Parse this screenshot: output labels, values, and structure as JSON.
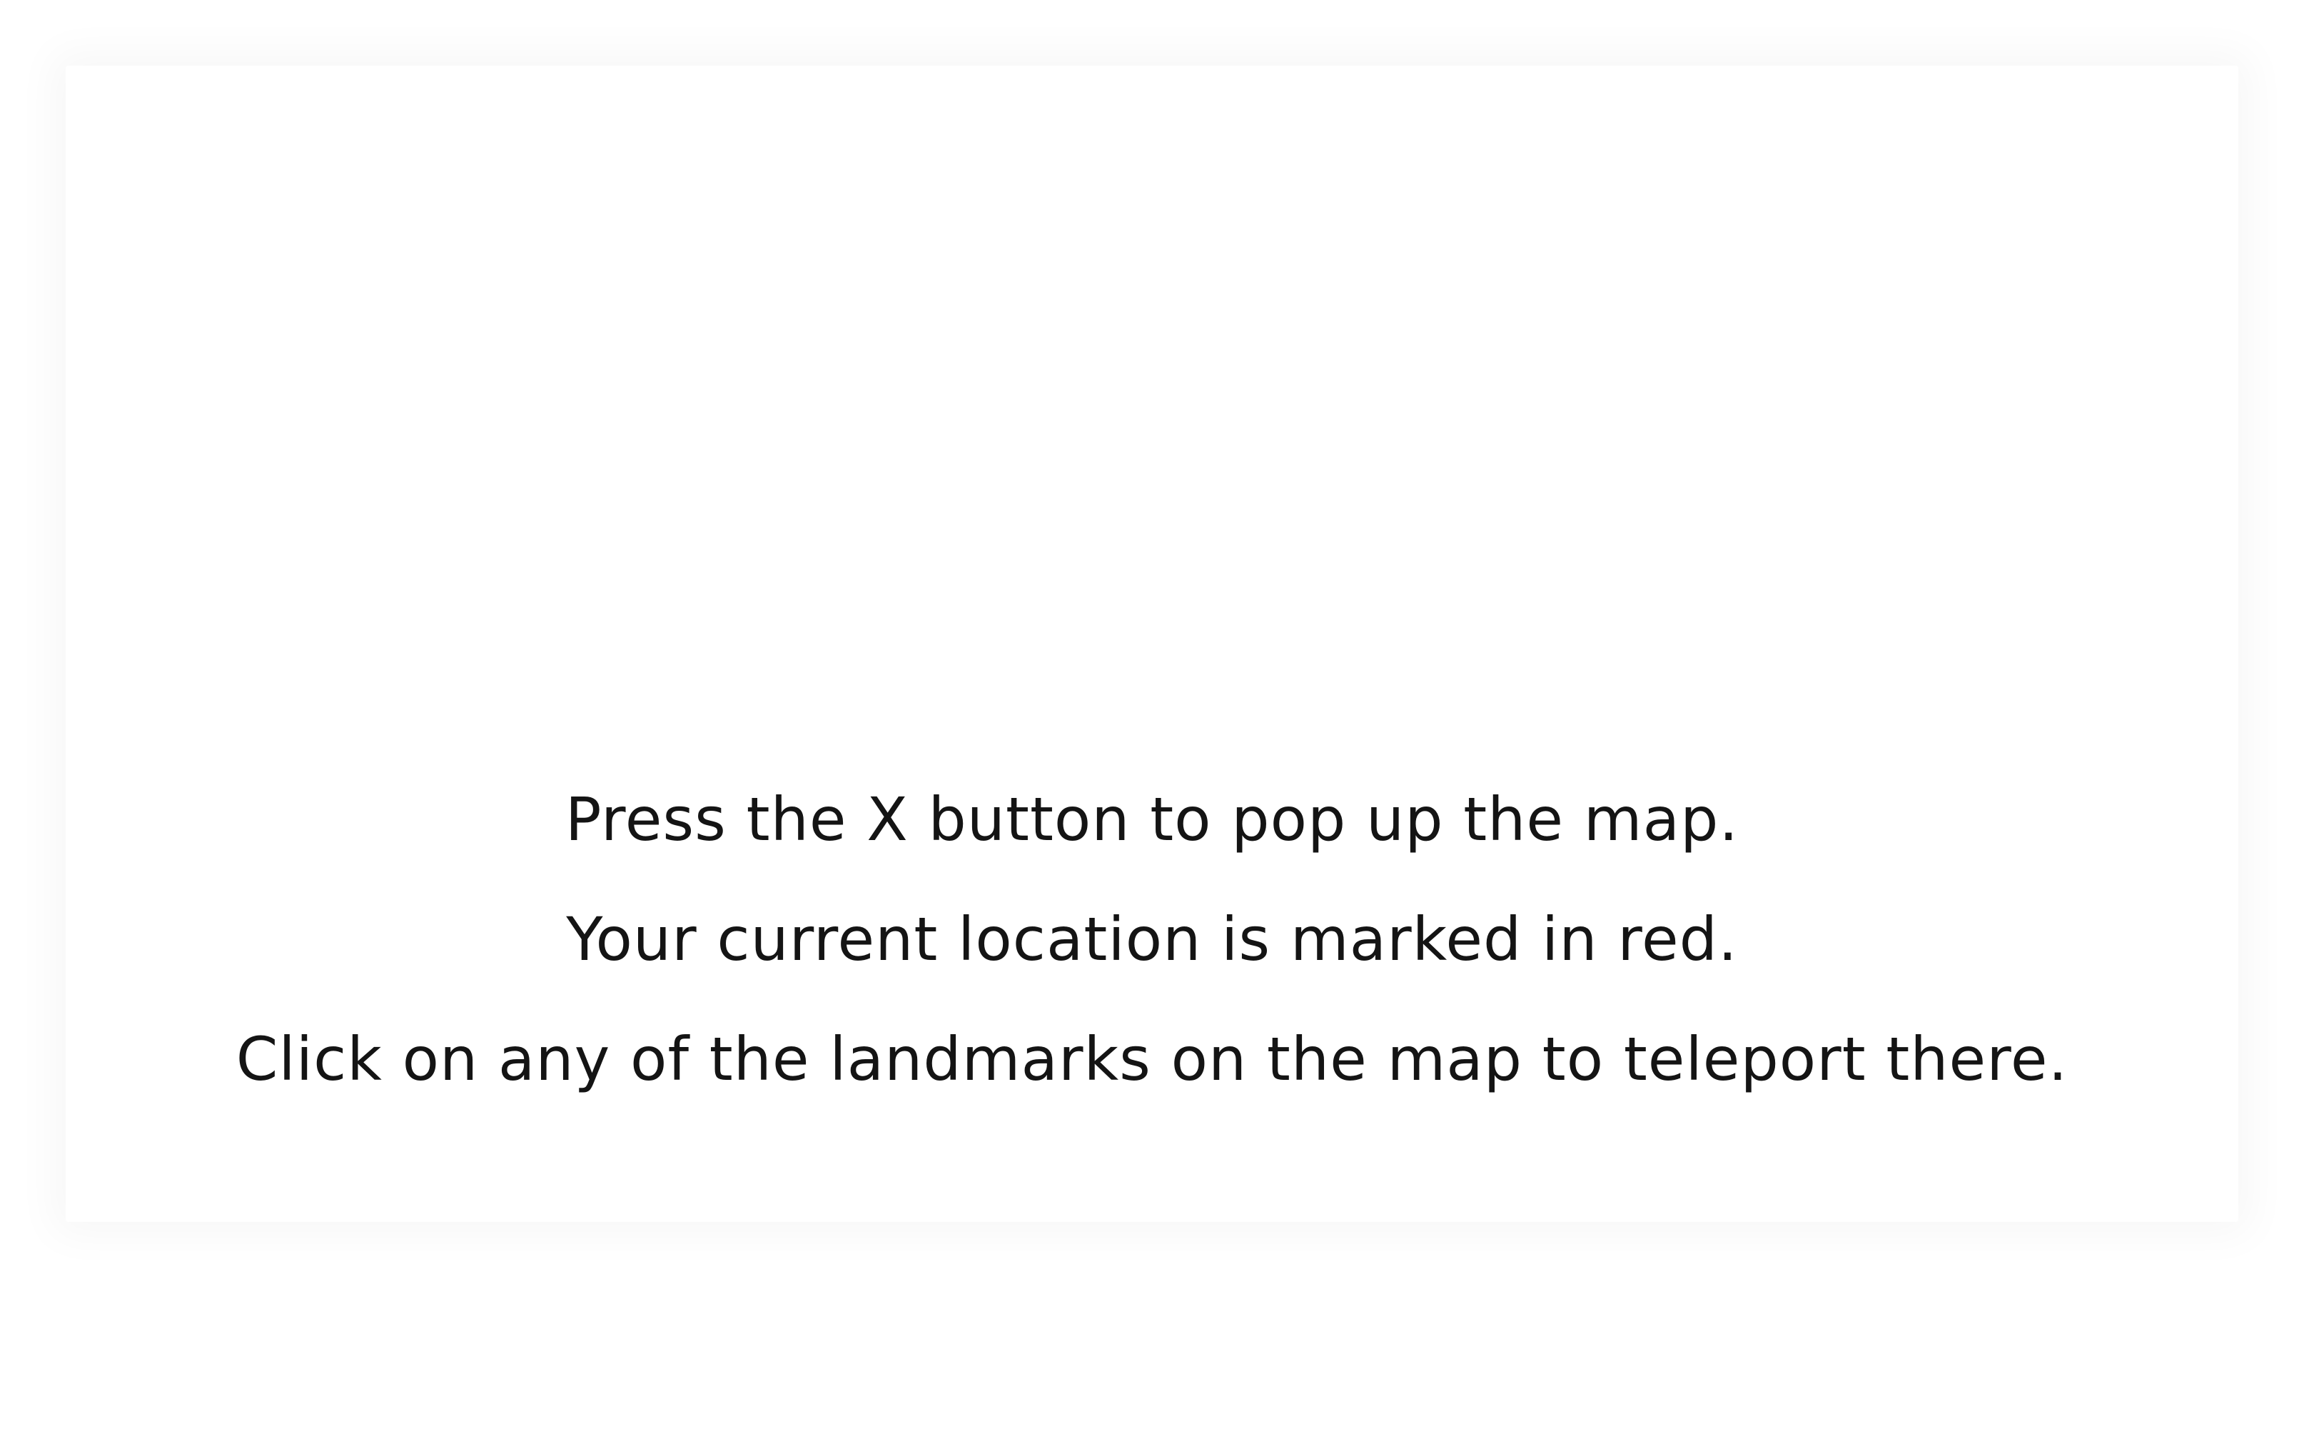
{
  "instructions": {
    "line1": "Press the X button to pop up the map.",
    "line2": "Your current location is marked in red.",
    "line3": "Click on any of the landmarks on the map to teleport there."
  },
  "colors": {
    "background": "#ffffff",
    "text": "#141414"
  }
}
